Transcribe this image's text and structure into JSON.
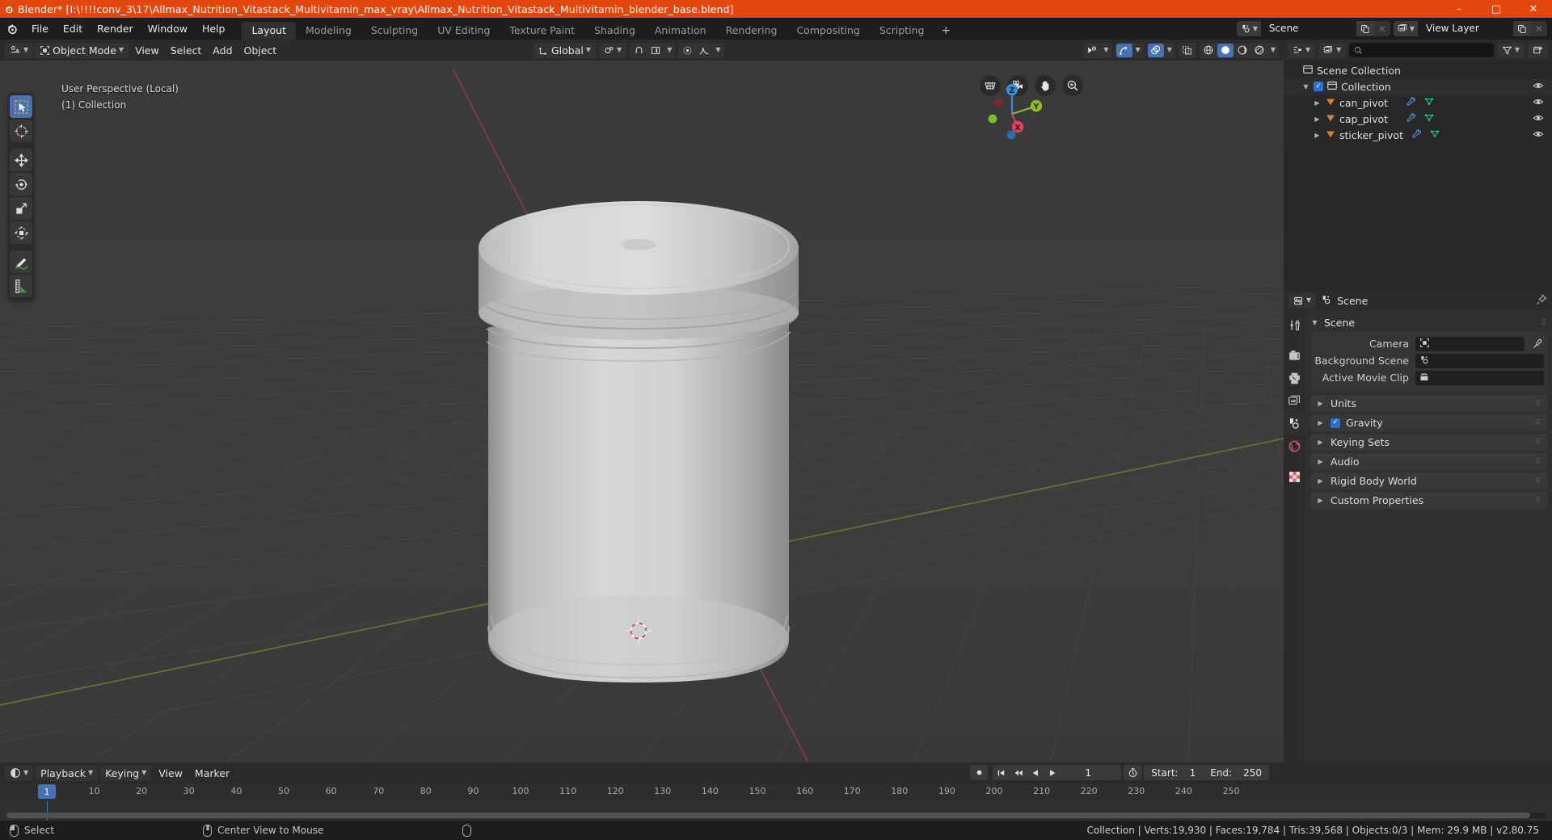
{
  "window": {
    "title": "Blender* [I:\\!!!!conv_3\\17\\Allmax_Nutrition_Vitastack_Multivitamin_max_vray\\Allmax_Nutrition_Vitastack_Multivitamin_blender_base.blend]",
    "minimize": "–",
    "maximize": "□",
    "close": "✕",
    "accent": "#e4470d"
  },
  "topbar": {
    "menus": [
      "File",
      "Edit",
      "Render",
      "Window",
      "Help"
    ],
    "workspaces": [
      {
        "label": "Layout",
        "active": true
      },
      {
        "label": "Modeling",
        "active": false
      },
      {
        "label": "Sculpting",
        "active": false
      },
      {
        "label": "UV Editing",
        "active": false
      },
      {
        "label": "Texture Paint",
        "active": false
      },
      {
        "label": "Shading",
        "active": false
      },
      {
        "label": "Animation",
        "active": false
      },
      {
        "label": "Rendering",
        "active": false
      },
      {
        "label": "Compositing",
        "active": false
      },
      {
        "label": "Scripting",
        "active": false
      }
    ],
    "add_workspace": "+",
    "scene_name": "Scene",
    "view_layer_name": "View Layer"
  },
  "viewport": {
    "header": {
      "editor_type": "editor-type-3dview",
      "mode": "Object Mode",
      "menus": [
        "View",
        "Select",
        "Add",
        "Object"
      ],
      "transform_orientation": "Global",
      "snap_label": "snapping",
      "proportional_label": "proportional-editing"
    },
    "overlay": {
      "line1": "User Perspective (Local)",
      "line2": "(1) Collection"
    },
    "gizmo_axes": [
      "X",
      "Y",
      "Z"
    ],
    "nav_icons": [
      "grid-ortho-icon",
      "camera-view-icon",
      "hand-pan-icon",
      "zoom-icon"
    ],
    "tools": [
      {
        "name": "select-box-tool",
        "active": true
      },
      {
        "name": "cursor-tool",
        "active": false
      },
      {
        "name": "move-tool",
        "active": false
      },
      {
        "name": "rotate-tool",
        "active": false
      },
      {
        "name": "scale-tool",
        "active": false
      },
      {
        "name": "transform-tool",
        "active": false
      },
      {
        "name": "annotate-tool",
        "active": false
      },
      {
        "name": "measure-tool",
        "active": false
      }
    ]
  },
  "outliner": {
    "search_placeholder": "",
    "display_mode": "View Layer",
    "rows": [
      {
        "label": "Scene Collection",
        "icon": "scene-collection-icon",
        "indent": 0,
        "has_checkbox": false,
        "has_expander": false,
        "has_eye": false,
        "has_modifier": false,
        "has_mesh": false
      },
      {
        "label": "Collection",
        "icon": "collection-icon",
        "indent": 1,
        "has_checkbox": true,
        "has_expander": true,
        "has_eye": true,
        "has_modifier": false,
        "has_mesh": false
      },
      {
        "label": "can_pivot",
        "icon": "empty-object-icon",
        "indent": 2,
        "has_checkbox": false,
        "has_expander": true,
        "has_eye": true,
        "has_modifier": true,
        "has_mesh": true
      },
      {
        "label": "cap_pivot",
        "icon": "empty-object-icon",
        "indent": 2,
        "has_checkbox": false,
        "has_expander": true,
        "has_eye": true,
        "has_modifier": true,
        "has_mesh": true
      },
      {
        "label": "sticker_pivot",
        "icon": "empty-object-icon",
        "indent": 2,
        "has_checkbox": false,
        "has_expander": true,
        "has_eye": true,
        "has_modifier": true,
        "has_mesh": true
      }
    ]
  },
  "properties": {
    "breadcrumb": "Scene",
    "tabs": [
      {
        "name": "tool-tab",
        "active": false
      },
      {
        "name": "render-tab",
        "active": false
      },
      {
        "name": "output-tab",
        "active": false
      },
      {
        "name": "view-layer-tab",
        "active": false
      },
      {
        "name": "scene-tab",
        "active": true
      },
      {
        "name": "world-tab",
        "active": false
      },
      {
        "name": "texture-tab",
        "active": false
      }
    ],
    "scene_panel": {
      "title": "Scene",
      "rows": [
        {
          "label": "Camera",
          "value": "",
          "icon": "camera-data-icon",
          "eyedropper": true
        },
        {
          "label": "Background Scene",
          "value": "",
          "icon": "scene-icon",
          "eyedropper": false
        },
        {
          "label": "Active Movie Clip",
          "value": "",
          "icon": "clip-icon",
          "eyedropper": false
        }
      ]
    },
    "closed_panels": [
      {
        "label": "Units",
        "checkbox": false
      },
      {
        "label": "Gravity",
        "checkbox": true
      },
      {
        "label": "Keying Sets",
        "checkbox": false
      },
      {
        "label": "Audio",
        "checkbox": false
      },
      {
        "label": "Rigid Body World",
        "checkbox": false
      },
      {
        "label": "Custom Properties",
        "checkbox": false
      }
    ]
  },
  "timeline": {
    "menus": [
      "Playback",
      "Keying",
      "View",
      "Marker"
    ],
    "current_frame": "1",
    "start_label": "Start:",
    "start_value": "1",
    "end_label": "End:",
    "end_value": "250",
    "ticks": [
      "1",
      "10",
      "20",
      "30",
      "40",
      "50",
      "60",
      "70",
      "80",
      "90",
      "100",
      "110",
      "120",
      "130",
      "140",
      "150",
      "160",
      "170",
      "180",
      "190",
      "200",
      "210",
      "220",
      "230",
      "240",
      "250"
    ],
    "playhead_frame": "1"
  },
  "statusbar": {
    "left_hint": "Select",
    "mid_hint": "Center View to Mouse",
    "stats": "Collection | Verts:19,930 | Faces:19,784 | Tris:39,568 | Objects:0/3 | Mem: 29.9 MB | v2.80.75"
  },
  "colors": {
    "accent_blue": "#4772b3",
    "orange": "#e4470d",
    "x_axis": "#d9455a",
    "y_axis": "#8fbb26",
    "z_axis": "#3b8ddb"
  }
}
